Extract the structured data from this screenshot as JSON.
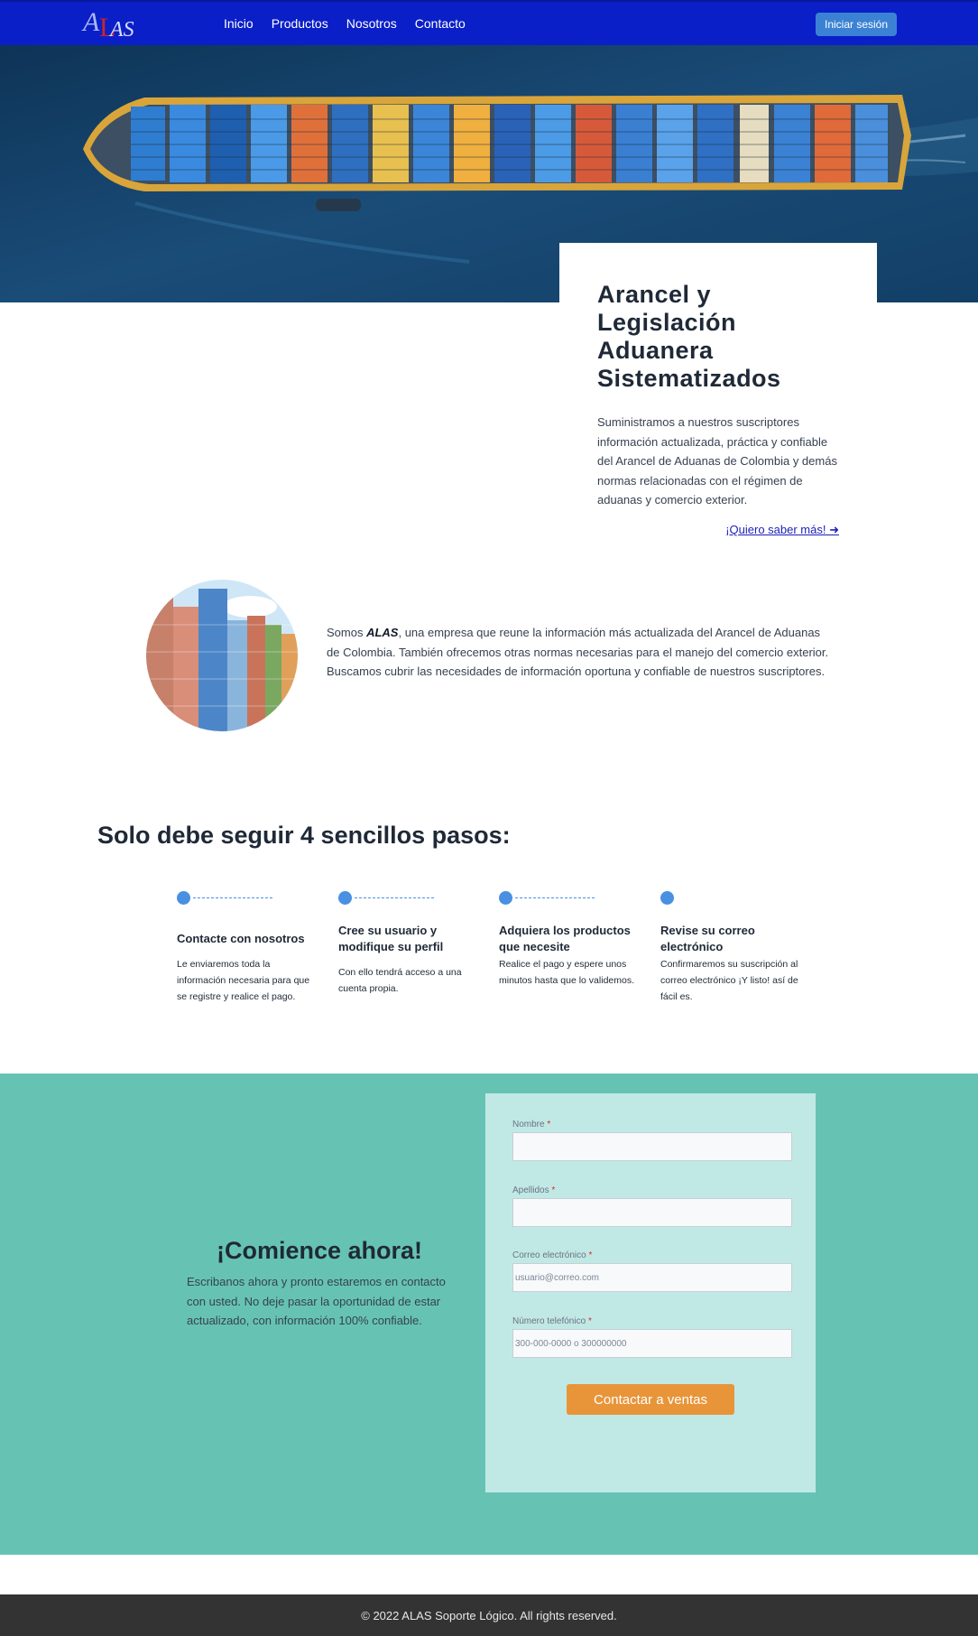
{
  "nav": {
    "logo_text": "ALAS",
    "links": [
      "Inicio",
      "Productos",
      "Nosotros",
      "Contacto"
    ],
    "login_label": "Iniciar sesión",
    "bg_color": "#0a1fc8"
  },
  "hero": {
    "title": "Arancel y Legislación Aduanera Sistematizados",
    "description": "Suministramos a nuestros suscriptores información actualizada, práctica y confiable del Arancel de Aduanas de Colombia y demás normas relacionadas con el régimen de aduanas y comercio exterior.",
    "link_label": "¡Quiero saber más! ➜"
  },
  "about": {
    "prefix": "Somos ",
    "brand": "ALAS",
    "text": ", una empresa que reune la información más actualizada del Arancel de Aduanas de Colombia. También ofrecemos otras normas necesarias para el manejo del comercio exterior. Buscamos cubrir las necesidades de información oportuna y confiable de nuestros suscriptores."
  },
  "steps": {
    "title": "Solo debe seguir 4 sencillos pasos:",
    "items": [
      {
        "title": "Contacte con nosotros",
        "text": "Le enviaremos toda la información necesaria para que se registre y realice el pago."
      },
      {
        "title": "Cree su usuario y modifique su perfil",
        "text": "Con ello tendrá acceso a una cuenta propia."
      },
      {
        "title": "Adquiera los productos que necesite",
        "text": "Realice el pago y espere unos minutos hasta que lo validemos."
      },
      {
        "title": "Revise su correo electrónico",
        "text": "Confirmaremos su suscripción al correo electrónico ¡Y listo! así de fácil es."
      }
    ]
  },
  "cta": {
    "title": "¡Comience ahora!",
    "text": "Escribanos ahora y pronto estaremos en contacto con usted. No deje pasar la oportunidad de estar actualizado, con información 100% confiable.",
    "bg_color": "#66c3b4"
  },
  "form": {
    "required_mark": "*",
    "fields": [
      {
        "label": "Nombre",
        "value": "",
        "placeholder": ""
      },
      {
        "label": "Apellidos",
        "value": "",
        "placeholder": ""
      },
      {
        "label": "Correo electrónico",
        "value": "",
        "placeholder": "usuario@correo.com"
      },
      {
        "label": "Número telefónico",
        "value": "",
        "placeholder": "300-000-0000 o 300000000"
      }
    ],
    "submit_label": "Contactar a ventas",
    "submit_color": "#e8953a"
  },
  "footer": {
    "text": "© 2022 ALAS Soporte Lógico. All rights reserved."
  }
}
